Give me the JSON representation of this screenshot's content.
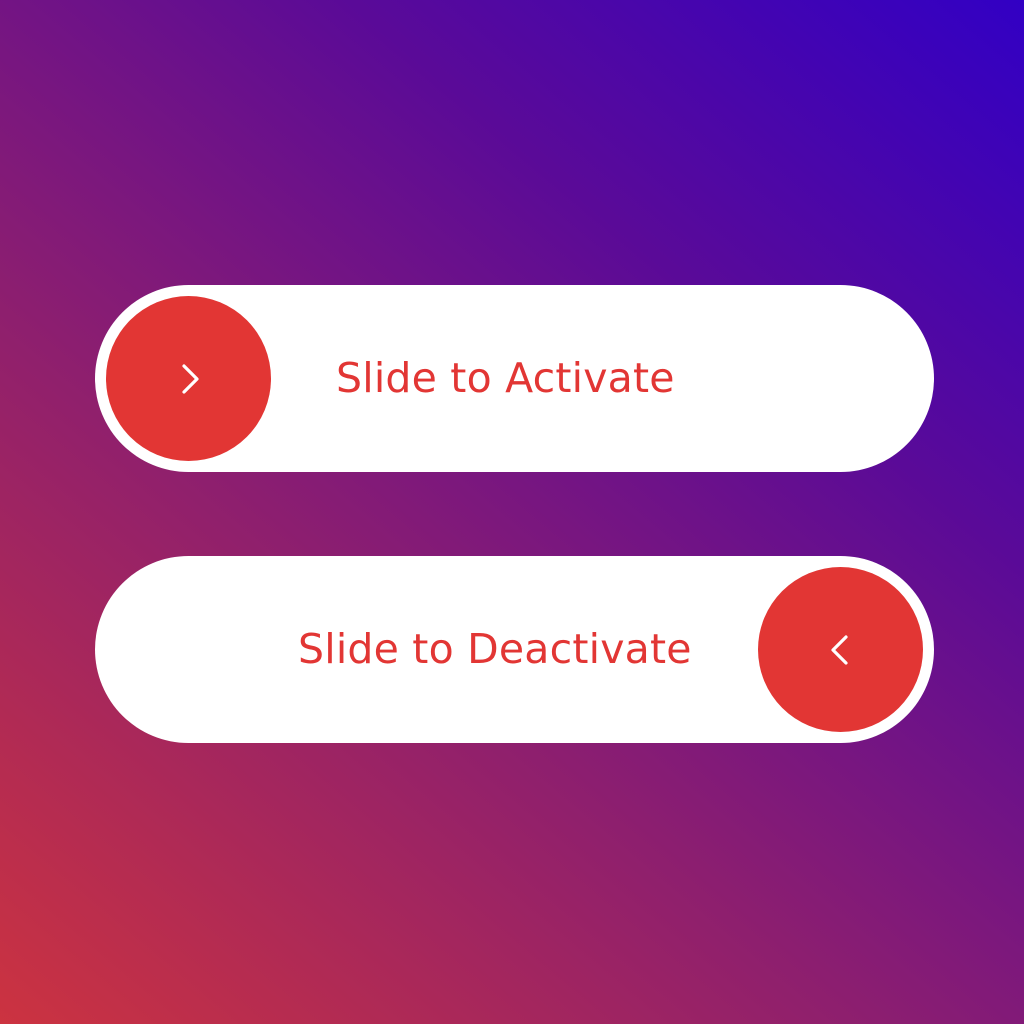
{
  "theme": {
    "accent": "#e23634",
    "track": "#ffffff",
    "gradient": [
      "#cc3340",
      "#8e1f6e",
      "#5a0a98",
      "#3200c4"
    ]
  },
  "sliders": [
    {
      "label": "Slide to Activate",
      "knob_icon": "chevron-right-icon",
      "state": "off"
    },
    {
      "label": "Slide to Deactivate",
      "knob_icon": "chevron-left-icon",
      "state": "on"
    }
  ]
}
